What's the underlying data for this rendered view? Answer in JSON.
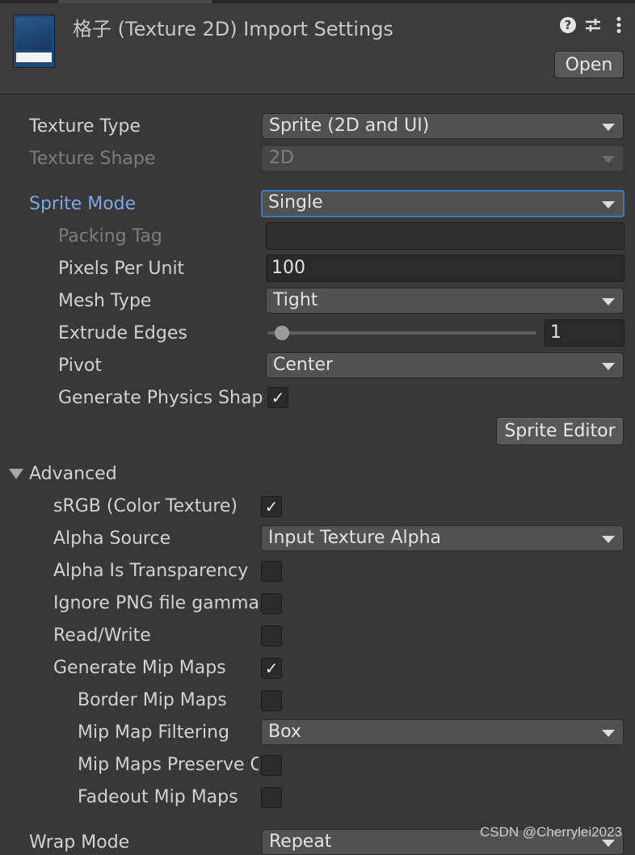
{
  "header": {
    "title": "格子 (Texture 2D) Import Settings",
    "open_label": "Open",
    "icons": [
      "help-icon",
      "presets-sliders-icon",
      "kebab-menu-icon"
    ]
  },
  "fields": {
    "texture_type": {
      "label": "Texture Type",
      "value": "Sprite (2D and UI)"
    },
    "texture_shape": {
      "label": "Texture Shape",
      "value": "2D"
    },
    "sprite_mode": {
      "label": "Sprite Mode",
      "value": "Single"
    },
    "packing_tag": {
      "label": "Packing Tag",
      "value": ""
    },
    "pixels_per_unit": {
      "label": "Pixels Per Unit",
      "value": "100"
    },
    "mesh_type": {
      "label": "Mesh Type",
      "value": "Tight"
    },
    "extrude_edges": {
      "label": "Extrude Edges",
      "value": "1",
      "slider_fraction": 0.0
    },
    "pivot": {
      "label": "Pivot",
      "value": "Center"
    },
    "generate_physics_shape": {
      "label": "Generate Physics Shap",
      "checked": true
    },
    "sprite_editor_label": "Sprite Editor"
  },
  "advanced": {
    "label": "Advanced",
    "srgb": {
      "label": "sRGB (Color Texture)",
      "checked": true
    },
    "alpha_source": {
      "label": "Alpha Source",
      "value": "Input Texture Alpha"
    },
    "alpha_is_transparency": {
      "label": "Alpha Is Transparency",
      "checked": false
    },
    "ignore_png_gamma": {
      "label": "Ignore PNG file gamma",
      "checked": false
    },
    "read_write": {
      "label": "Read/Write",
      "checked": false
    },
    "generate_mip_maps": {
      "label": "Generate Mip Maps",
      "checked": true
    },
    "border_mip_maps": {
      "label": "Border Mip Maps",
      "checked": false
    },
    "mip_map_filtering": {
      "label": "Mip Map Filtering",
      "value": "Box"
    },
    "mip_maps_preserve": {
      "label": "Mip Maps Preserve Coverage",
      "checked": false
    },
    "fadeout_mip_maps": {
      "label": "Fadeout Mip Maps",
      "checked": false
    }
  },
  "wrap_mode": {
    "label": "Wrap Mode",
    "value": "Repeat"
  },
  "watermark": "CSDN @Cherrylei2023",
  "check_glyph": "✓"
}
